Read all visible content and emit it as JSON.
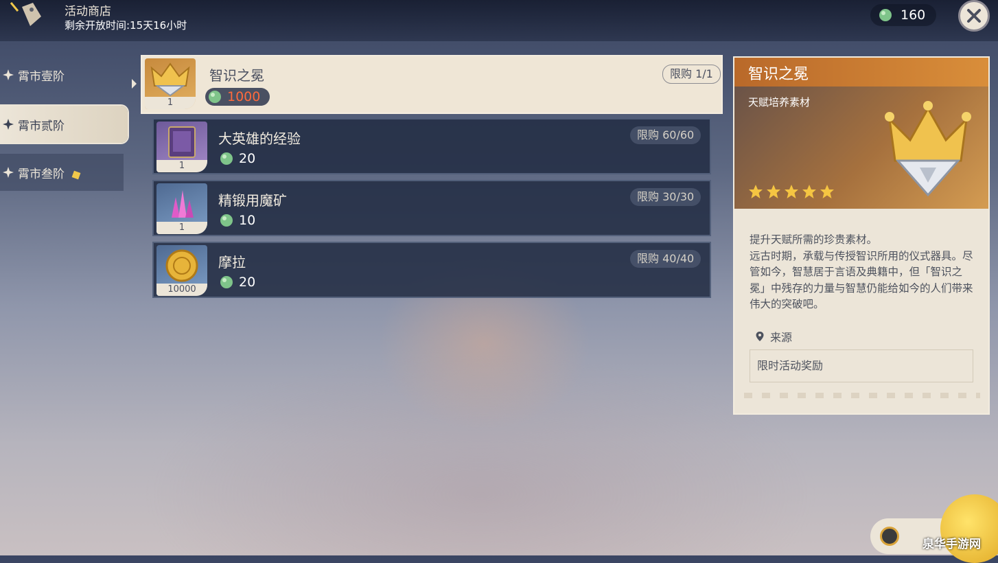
{
  "header": {
    "title": "活动商店",
    "timer": "剩余开放时间:15天16小时",
    "currency_amount": "160"
  },
  "tabs": [
    {
      "label": "霄市壹阶"
    },
    {
      "label": "霄市贰阶"
    },
    {
      "label": "霄市叁阶"
    }
  ],
  "items": [
    {
      "name": "智识之冕",
      "qty": "1",
      "price": "1000",
      "limit": "限购 1/1"
    },
    {
      "name": "大英雄的经验",
      "qty": "1",
      "price": "20",
      "limit": "限购 60/60"
    },
    {
      "name": "精锻用魔矿",
      "qty": "1",
      "price": "10",
      "limit": "限购 30/30"
    },
    {
      "name": "摩拉",
      "qty": "10000",
      "price": "20",
      "limit": "限购 40/40"
    }
  ],
  "detail": {
    "title": "智识之冕",
    "type": "天赋培养素材",
    "rarity": 5,
    "description": "提升天赋所需的珍贵素材。\n远古时期，承载与传授智识所用的仪式器具。尽管如今，智慧居于言语及典籍中，但「智识之冕」中残存的力量与智慧仍能给如今的人们带来伟大的突破吧。",
    "source_label": "来源",
    "source_value": "限时活动奖励"
  },
  "watermark": "泉华手游网",
  "colors": {
    "accent_orange": "#d98e3a",
    "price_highlight": "#ff6a3c",
    "panel_cream": "#ece5d8",
    "star_gold": "#f5c542"
  }
}
